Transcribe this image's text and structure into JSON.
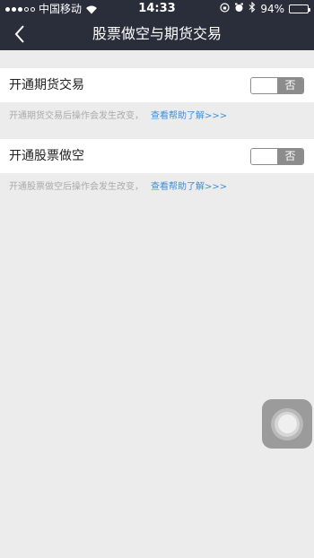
{
  "status_bar": {
    "carrier": "中国移动",
    "time": "14:33",
    "battery": "94%",
    "battery_level": 0.94
  },
  "header": {
    "title": "股票做空与期货交易"
  },
  "settings": [
    {
      "label": "开通期货交易",
      "toggle_text": "否",
      "enabled": false,
      "hint": "开通期货交易后操作会发生改变，",
      "link": "查看帮助了解>>>"
    },
    {
      "label": "开通股票做空",
      "toggle_text": "否",
      "enabled": false,
      "hint": "开通股票做空后操作会发生改变，",
      "link": "查看帮助了解>>>"
    }
  ],
  "icons": [
    "signal-dots-icon",
    "wifi-icon",
    "rotation-lock-icon",
    "alarm-icon",
    "bluetooth-icon",
    "battery-icon",
    "back-arrow-icon",
    "assistive-touch-icon"
  ],
  "colors": {
    "header_bg": "#2a2e3b",
    "page_bg": "#ececec",
    "link": "#3e8ed9",
    "toggle_off": "#8c8c8c"
  }
}
